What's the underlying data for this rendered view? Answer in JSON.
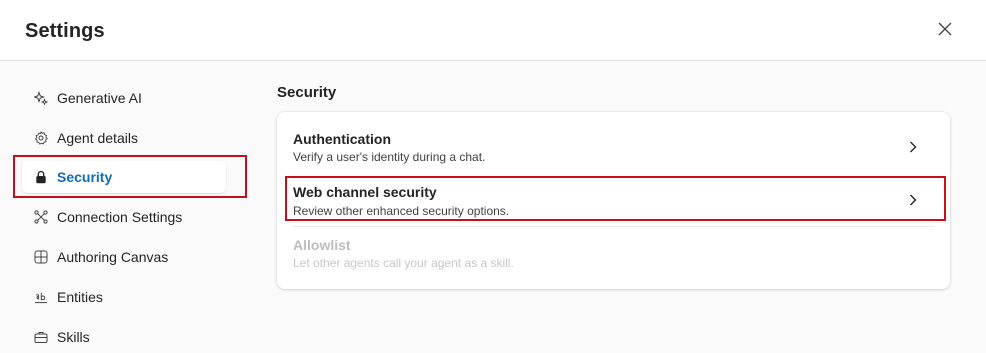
{
  "header": {
    "title": "Settings",
    "close_icon": "close-icon"
  },
  "sidebar": {
    "items": [
      {
        "label": "Generative AI",
        "icon": "sparkle-icon"
      },
      {
        "label": "Agent details",
        "icon": "gear-icon"
      },
      {
        "label": "Security",
        "icon": "lock-icon",
        "active": true
      },
      {
        "label": "Connection Settings",
        "icon": "connection-icon"
      },
      {
        "label": "Authoring Canvas",
        "icon": "grid-icon"
      },
      {
        "label": "Entities",
        "icon": "text-ab-icon"
      },
      {
        "label": "Skills",
        "icon": "briefcase-icon"
      }
    ]
  },
  "main": {
    "section_title": "Security",
    "options": [
      {
        "title": "Authentication",
        "description": "Verify a user's identity during a chat.",
        "enabled": true
      },
      {
        "title": "Web channel security",
        "description": "Review other enhanced security options.",
        "enabled": true
      },
      {
        "title": "Allowlist",
        "description": "Let other agents call your agent as a skill.",
        "enabled": false
      }
    ]
  },
  "colors": {
    "accent": "#0f6cbd",
    "highlight": "#c50f1f",
    "disabled_text": "#bdbdbd",
    "background": "#fafafa"
  }
}
